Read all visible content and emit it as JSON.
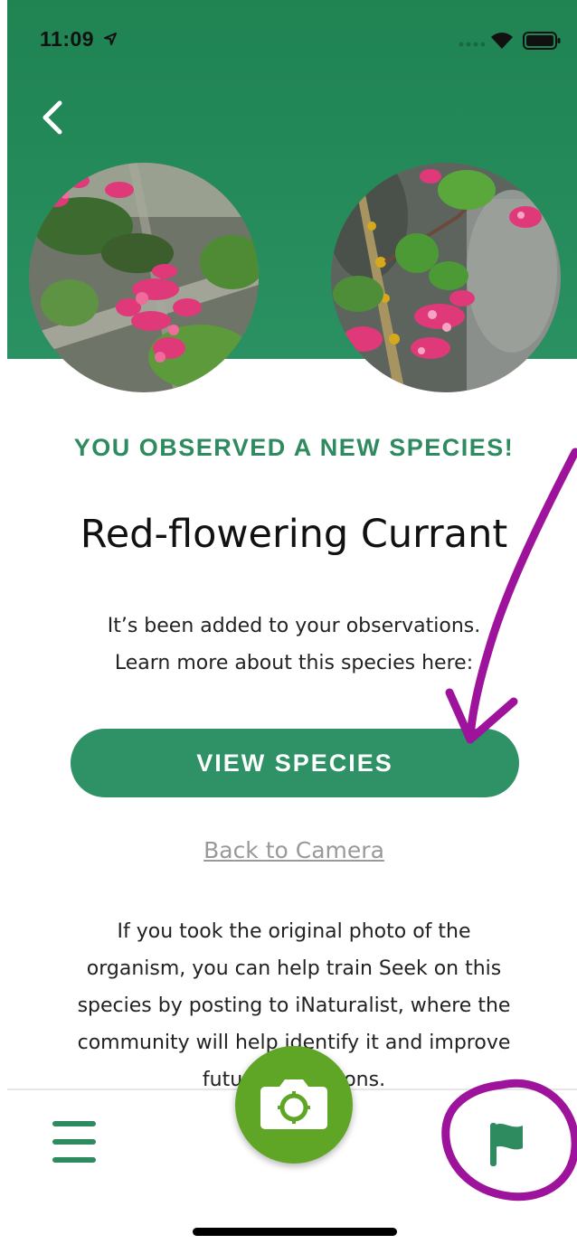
{
  "status_bar": {
    "time": "11:09"
  },
  "icons": {
    "back": "chevron-left-icon",
    "location": "location-arrow-icon",
    "wifi": "wifi-icon",
    "battery": "battery-icon",
    "menu": "hamburger-menu-icon",
    "camera": "camera-icon",
    "flag": "flag-icon"
  },
  "result": {
    "headline": "YOU OBSERVED A NEW SPECIES!",
    "species_name": "Red-flowering Currant",
    "intro_line1": "It’s been added to your observations.",
    "intro_line2": "Learn more about this species here:",
    "view_species_label": "VIEW SPECIES",
    "back_to_camera_label": "Back to Camera",
    "body_line1": "If you took the original photo of the",
    "body_line2": "organism, you can help train Seek on this",
    "body_line3": "species by posting to iNaturalist, where the",
    "body_line4": "community will help identify it and improve",
    "body_line5": "future predictions."
  },
  "colors": {
    "header_green": "#2a8f5f",
    "accent_green": "#2f9166",
    "camera_green": "#5fa627",
    "annotation_purple": "#9e139c",
    "flower_pink": "#e0397a"
  }
}
